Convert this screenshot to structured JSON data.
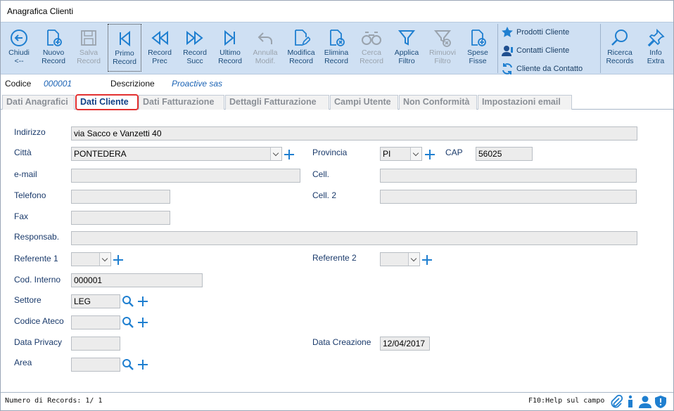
{
  "window": {
    "title": "Anagrafica Clienti"
  },
  "toolbar": {
    "buttons": [
      {
        "label": "Chiudi\n<--",
        "icon": "close-back-icon",
        "enabled": true
      },
      {
        "label": "Nuovo\nRecord",
        "icon": "new-document-icon",
        "enabled": true
      },
      {
        "label": "Salva\nRecord",
        "icon": "save-icon",
        "enabled": false
      },
      {
        "label": "Primo\nRecord",
        "icon": "first-record-icon",
        "enabled": true
      },
      {
        "label": "Record\nPrec",
        "icon": "previous-record-icon",
        "enabled": true
      },
      {
        "label": "Record\nSucc",
        "icon": "next-record-icon",
        "enabled": true
      },
      {
        "label": "Ultimo\nRecord",
        "icon": "last-record-icon",
        "enabled": true
      },
      {
        "label": "Annulla\nModif.",
        "icon": "undo-icon",
        "enabled": false
      },
      {
        "label": "Modifica\nRecord",
        "icon": "edit-document-icon",
        "enabled": true
      },
      {
        "label": "Elimina\nRecord",
        "icon": "delete-document-icon",
        "enabled": true
      },
      {
        "label": "Cerca\nRecord",
        "icon": "binoculars-icon",
        "enabled": false
      },
      {
        "label": "Applica\nFiltro",
        "icon": "filter-icon",
        "enabled": true
      },
      {
        "label": "Rimuovi\nFiltro",
        "icon": "remove-filter-icon",
        "enabled": false
      },
      {
        "label": "Spese\nFisse",
        "icon": "add-document-icon",
        "enabled": true
      }
    ],
    "links": {
      "prodotti": "Prodotti Cliente",
      "contatti": "Contatti Cliente",
      "cliente_contatto": "Cliente da Contatto"
    },
    "right": [
      {
        "label": "Ricerca\nRecords",
        "icon": "search-icon"
      },
      {
        "label": "Info\nExtra",
        "icon": "pin-icon"
      }
    ]
  },
  "record": {
    "codice_label": "Codice",
    "codice_value": "000001",
    "descrizione_label": "Descrizione",
    "descrizione_value": "Proactive sas"
  },
  "tabs": [
    "Dati Anagrafici",
    "Dati Cliente",
    "Dati Fatturazione",
    "Dettagli Fatturazione",
    "Campi Utente",
    "Non Conformità",
    "Impostazioni email"
  ],
  "active_tab": "Dati Cliente",
  "form": {
    "indirizzo": {
      "label": "Indirizzo",
      "value": "via Sacco e Vanzetti 40"
    },
    "citta": {
      "label": "Città",
      "value": "PONTEDERA"
    },
    "provincia": {
      "label": "Provincia",
      "value": "PI"
    },
    "cap": {
      "label": "CAP",
      "value": "56025"
    },
    "email": {
      "label": "e-mail",
      "value": ""
    },
    "cell": {
      "label": "Cell.",
      "value": ""
    },
    "telefono": {
      "label": "Telefono",
      "value": ""
    },
    "cell2": {
      "label": "Cell. 2",
      "value": ""
    },
    "fax": {
      "label": "Fax",
      "value": ""
    },
    "responsab": {
      "label": "Responsab.",
      "value": ""
    },
    "referente1": {
      "label": "Referente 1",
      "value": ""
    },
    "referente2": {
      "label": "Referente 2",
      "value": ""
    },
    "cod_interno": {
      "label": "Cod. Interno",
      "value": "000001"
    },
    "settore": {
      "label": "Settore",
      "value": "LEG"
    },
    "codice_ateco": {
      "label": "Codice Ateco",
      "value": ""
    },
    "data_privacy": {
      "label": "Data Privacy",
      "value": ""
    },
    "data_creazione": {
      "label": "Data Creazione",
      "value": "12/04/2017"
    },
    "area": {
      "label": "Area",
      "value": ""
    }
  },
  "status": {
    "records": "Numero di Records: 1/ 1",
    "help": "F10:Help sul campo"
  },
  "colors": {
    "toolbar_bg": "#cfe0f3",
    "icon_blue": "#1f7fd0",
    "active_tab_border": "#e23030",
    "label_color": "#1a3a6b"
  }
}
